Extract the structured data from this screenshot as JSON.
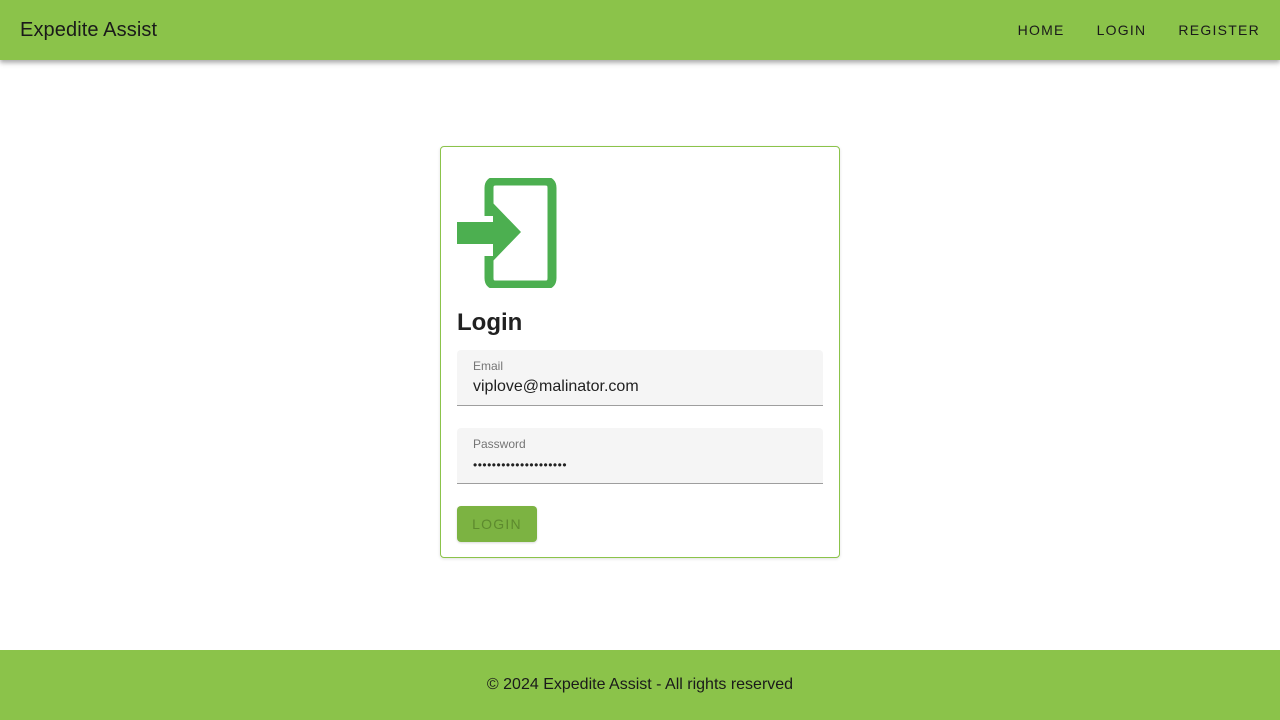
{
  "header": {
    "brand": "Expedite Assist",
    "nav": [
      {
        "label": "HOME"
      },
      {
        "label": "LOGIN"
      },
      {
        "label": "REGISTER"
      }
    ]
  },
  "login_card": {
    "icon": "login-icon",
    "title": "Login",
    "email": {
      "label": "Email",
      "value": "viplove@malinator.com"
    },
    "password": {
      "label": "Password",
      "value": "••••••••••••••••••••"
    },
    "submit_label": "LOGIN"
  },
  "footer": {
    "text": "© 2024 Expedite Assist - All rights reserved"
  },
  "colors": {
    "primary": "#8bc34a",
    "icon": "#4caf50",
    "button": "#7cb342"
  }
}
